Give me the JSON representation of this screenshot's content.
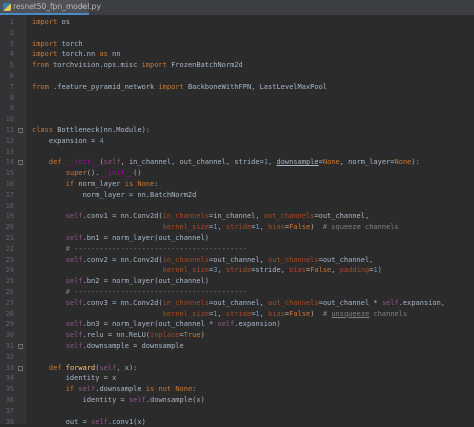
{
  "tab": {
    "filename": "resnet50_fpn_model.py",
    "close": "×",
    "icon": "python-file-icon"
  },
  "colors": {
    "background": "#2b2b2b",
    "gutter": "#313335",
    "keyword": "#cc7832",
    "function": "#ffc66d",
    "number": "#6897bb",
    "self": "#94558d",
    "param": "#aa4926",
    "comment": "#808080",
    "text": "#a9b7c6"
  },
  "lines": [
    {
      "n": "1",
      "tokens": [
        [
          "kw",
          "import"
        ],
        [
          "t",
          " os"
        ]
      ]
    },
    {
      "n": "2",
      "tokens": []
    },
    {
      "n": "3",
      "tokens": [
        [
          "kw",
          "import"
        ],
        [
          "t",
          " torch"
        ]
      ]
    },
    {
      "n": "4",
      "tokens": [
        [
          "kw",
          "import"
        ],
        [
          "t",
          " torch.nn "
        ],
        [
          "kw",
          "as"
        ],
        [
          "t",
          " nn"
        ]
      ]
    },
    {
      "n": "5",
      "tokens": [
        [
          "kw",
          "from"
        ],
        [
          "t",
          " torchvision.ops.misc "
        ],
        [
          "kw",
          "import"
        ],
        [
          "t",
          " FrozenBatchNorm2d"
        ]
      ]
    },
    {
      "n": "6",
      "tokens": []
    },
    {
      "n": "7",
      "tokens": [
        [
          "kw",
          "from"
        ],
        [
          "t",
          " .feature_pyramid_network "
        ],
        [
          "kw",
          "import"
        ],
        [
          "t",
          " BackboneWithFPN, LastLevelMaxPool"
        ]
      ]
    },
    {
      "n": "8",
      "tokens": []
    },
    {
      "n": "9",
      "tokens": []
    },
    {
      "n": "10",
      "tokens": []
    },
    {
      "n": "11",
      "tokens": [
        [
          "kw",
          "class"
        ],
        [
          "t",
          " Bottleneck(nn.Module):"
        ]
      ]
    },
    {
      "n": "12",
      "tokens": [
        [
          "t",
          "    expansion = "
        ],
        [
          "num",
          "4"
        ]
      ]
    },
    {
      "n": "13",
      "tokens": []
    },
    {
      "n": "14",
      "tokens": [
        [
          "t",
          "    "
        ],
        [
          "kw",
          "def"
        ],
        [
          "t",
          " "
        ],
        [
          "dunder",
          "__init__"
        ],
        [
          "t",
          "("
        ],
        [
          "self",
          "self"
        ],
        [
          "t",
          ", in_channel, out_channel, stride="
        ],
        [
          "num",
          "1"
        ],
        [
          "t",
          ", "
        ],
        [
          "u",
          "downsample"
        ],
        [
          "t",
          "="
        ],
        [
          "kw",
          "None"
        ],
        [
          "t",
          ", norm_layer="
        ],
        [
          "kw",
          "None"
        ],
        [
          "t",
          "):"
        ]
      ]
    },
    {
      "n": "15",
      "tokens": [
        [
          "t",
          "        "
        ],
        [
          "kw",
          "super"
        ],
        [
          "t",
          "()."
        ],
        [
          "dunder",
          "__init__"
        ],
        [
          "t",
          "()"
        ]
      ]
    },
    {
      "n": "16",
      "tokens": [
        [
          "t",
          "        "
        ],
        [
          "kw",
          "if"
        ],
        [
          "t",
          " norm_layer "
        ],
        [
          "kw",
          "is None"
        ],
        [
          "t",
          ":"
        ]
      ]
    },
    {
      "n": "17",
      "tokens": [
        [
          "t",
          "            norm_layer = nn.BatchNorm2d"
        ]
      ]
    },
    {
      "n": "18",
      "tokens": []
    },
    {
      "n": "19",
      "tokens": [
        [
          "t",
          "        "
        ],
        [
          "self",
          "self"
        ],
        [
          "t",
          ".conv1 = nn.Conv2d("
        ],
        [
          "par",
          "in_channels"
        ],
        [
          "t",
          "=in_channel, "
        ],
        [
          "par",
          "out_channels"
        ],
        [
          "t",
          "=out_channel,"
        ]
      ]
    },
    {
      "n": "20",
      "tokens": [
        [
          "t",
          "                               "
        ],
        [
          "par",
          "kernel_size"
        ],
        [
          "t",
          "="
        ],
        [
          "num",
          "1"
        ],
        [
          "t",
          ", "
        ],
        [
          "par",
          "stride"
        ],
        [
          "t",
          "="
        ],
        [
          "num",
          "1"
        ],
        [
          "t",
          ", "
        ],
        [
          "par",
          "bias"
        ],
        [
          "t",
          "="
        ],
        [
          "kw",
          "False"
        ],
        [
          "t",
          ")  "
        ],
        [
          "cm",
          "# squeeze channels"
        ]
      ]
    },
    {
      "n": "21",
      "tokens": [
        [
          "t",
          "        "
        ],
        [
          "self",
          "self"
        ],
        [
          "t",
          ".bn1 = norm_layer(out_channel)"
        ]
      ]
    },
    {
      "n": "22",
      "tokens": [
        [
          "t",
          "        "
        ],
        [
          "cm",
          "# -----------------------------------------"
        ]
      ]
    },
    {
      "n": "23",
      "tokens": [
        [
          "t",
          "        "
        ],
        [
          "self",
          "self"
        ],
        [
          "t",
          ".conv2 = nn.Conv2d("
        ],
        [
          "par",
          "in_channels"
        ],
        [
          "t",
          "=out_channel, "
        ],
        [
          "par",
          "out_channels"
        ],
        [
          "t",
          "=out_channel,"
        ]
      ]
    },
    {
      "n": "24",
      "tokens": [
        [
          "t",
          "                               "
        ],
        [
          "par",
          "kernel_size"
        ],
        [
          "t",
          "="
        ],
        [
          "num",
          "3"
        ],
        [
          "t",
          ", "
        ],
        [
          "par",
          "stride"
        ],
        [
          "t",
          "=stride, "
        ],
        [
          "par",
          "bias"
        ],
        [
          "t",
          "="
        ],
        [
          "kw",
          "False"
        ],
        [
          "t",
          ", "
        ],
        [
          "par",
          "padding"
        ],
        [
          "t",
          "="
        ],
        [
          "num",
          "1"
        ],
        [
          "t",
          ")"
        ]
      ]
    },
    {
      "n": "25",
      "tokens": [
        [
          "t",
          "        "
        ],
        [
          "self",
          "self"
        ],
        [
          "t",
          ".bn2 = norm_layer(out_channel)"
        ]
      ]
    },
    {
      "n": "26",
      "tokens": [
        [
          "t",
          "        "
        ],
        [
          "cm",
          "# -----------------------------------------"
        ]
      ]
    },
    {
      "n": "27",
      "tokens": [
        [
          "t",
          "        "
        ],
        [
          "self",
          "self"
        ],
        [
          "t",
          ".conv3 = nn.Conv2d("
        ],
        [
          "par",
          "in_channels"
        ],
        [
          "t",
          "=out_channel, "
        ],
        [
          "par",
          "out_channels"
        ],
        [
          "t",
          "=out_channel * "
        ],
        [
          "self",
          "self"
        ],
        [
          "t",
          ".expansion,"
        ]
      ]
    },
    {
      "n": "28",
      "tokens": [
        [
          "t",
          "                               "
        ],
        [
          "par",
          "kernel_size"
        ],
        [
          "t",
          "="
        ],
        [
          "num",
          "1"
        ],
        [
          "t",
          ", "
        ],
        [
          "par",
          "stride"
        ],
        [
          "t",
          "="
        ],
        [
          "num",
          "1"
        ],
        [
          "t",
          ", "
        ],
        [
          "par",
          "bias"
        ],
        [
          "t",
          "="
        ],
        [
          "kw",
          "False"
        ],
        [
          "t",
          ")  "
        ],
        [
          "cm",
          "# "
        ],
        [
          "cmu",
          "unsqueeze"
        ],
        [
          "cm",
          " channels"
        ]
      ]
    },
    {
      "n": "29",
      "tokens": [
        [
          "t",
          "        "
        ],
        [
          "self",
          "self"
        ],
        [
          "t",
          ".bn3 = norm_layer(out_channel * "
        ],
        [
          "self",
          "self"
        ],
        [
          "t",
          ".expansion)"
        ]
      ]
    },
    {
      "n": "30",
      "tokens": [
        [
          "t",
          "        "
        ],
        [
          "self",
          "self"
        ],
        [
          "t",
          ".relu = nn.ReLU("
        ],
        [
          "par",
          "inplace"
        ],
        [
          "t",
          "="
        ],
        [
          "kw",
          "True"
        ],
        [
          "t",
          ")"
        ]
      ]
    },
    {
      "n": "31",
      "tokens": [
        [
          "t",
          "        "
        ],
        [
          "self",
          "self"
        ],
        [
          "t",
          ".downsample = downsample"
        ]
      ]
    },
    {
      "n": "32",
      "tokens": []
    },
    {
      "n": "33",
      "tokens": [
        [
          "t",
          "    "
        ],
        [
          "kw",
          "def"
        ],
        [
          "t",
          " "
        ],
        [
          "fn",
          "forward"
        ],
        [
          "t",
          "("
        ],
        [
          "self",
          "self"
        ],
        [
          "t",
          ", x):"
        ]
      ]
    },
    {
      "n": "34",
      "tokens": [
        [
          "t",
          "        identity = x"
        ]
      ]
    },
    {
      "n": "35",
      "tokens": [
        [
          "t",
          "        "
        ],
        [
          "kw",
          "if"
        ],
        [
          "t",
          " "
        ],
        [
          "self",
          "self"
        ],
        [
          "t",
          ".downsample "
        ],
        [
          "kw",
          "is not None"
        ],
        [
          "t",
          ":"
        ]
      ]
    },
    {
      "n": "36",
      "tokens": [
        [
          "t",
          "            identity = "
        ],
        [
          "self",
          "self"
        ],
        [
          "t",
          ".downsample(x)"
        ]
      ]
    },
    {
      "n": "37",
      "tokens": []
    },
    {
      "n": "38",
      "tokens": [
        [
          "t",
          "        out = "
        ],
        [
          "self",
          "self"
        ],
        [
          "t",
          ".conv1(x)"
        ]
      ]
    }
  ]
}
